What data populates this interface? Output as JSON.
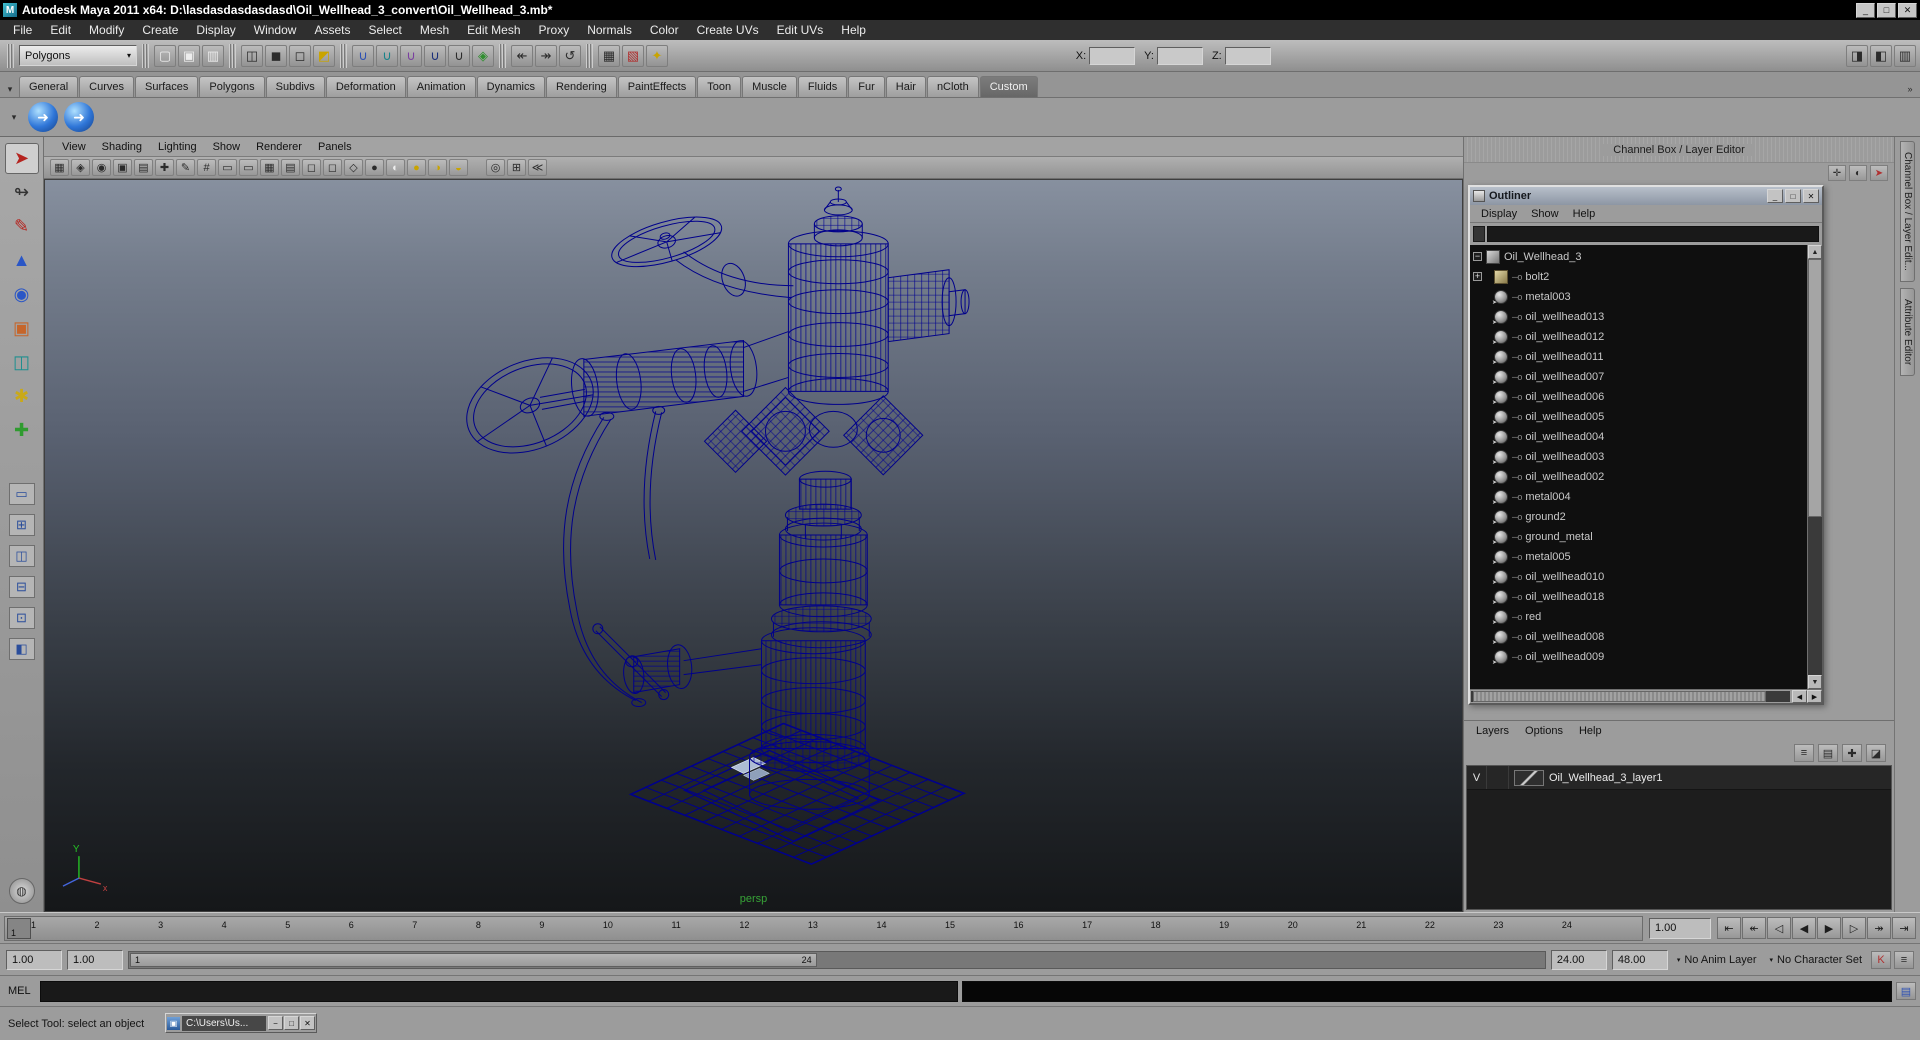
{
  "ui": {
    "caret_down": "▾"
  },
  "titlebar": {
    "app_initial": "M",
    "title": "Autodesk Maya 2011 x64: D:\\lasdasdasdasdasd\\Oil_Wellhead_3_convert\\Oil_Wellhead_3.mb*",
    "buttons": [
      {
        "name": "minimize-button",
        "glyph": "_"
      },
      {
        "name": "maximize-button",
        "glyph": "□"
      },
      {
        "name": "close-button",
        "glyph": "✕"
      }
    ]
  },
  "menu_bar": [
    {
      "name": "menu-file",
      "label": "File"
    },
    {
      "name": "menu-edit",
      "label": "Edit"
    },
    {
      "name": "menu-modify",
      "label": "Modify"
    },
    {
      "name": "menu-create",
      "label": "Create"
    },
    {
      "name": "menu-display",
      "label": "Display"
    },
    {
      "name": "menu-window",
      "label": "Window"
    },
    {
      "name": "menu-assets",
      "label": "Assets"
    },
    {
      "name": "menu-select",
      "label": "Select"
    },
    {
      "name": "menu-mesh",
      "label": "Mesh"
    },
    {
      "name": "menu-edit-mesh",
      "label": "Edit Mesh"
    },
    {
      "name": "menu-proxy",
      "label": "Proxy"
    },
    {
      "name": "menu-normals",
      "label": "Normals"
    },
    {
      "name": "menu-color",
      "label": "Color"
    },
    {
      "name": "menu-create-uvs",
      "label": "Create UVs"
    },
    {
      "name": "menu-edit-uvs",
      "label": "Edit UVs"
    },
    {
      "name": "menu-help",
      "label": "Help"
    }
  ],
  "statusline": {
    "mode": "Polygons",
    "icons_file": [
      {
        "name": "new-scene-icon",
        "glyph": "▢",
        "cls": "c-paper"
      },
      {
        "name": "open-scene-icon",
        "glyph": "▣",
        "cls": "c-paper"
      },
      {
        "name": "save-scene-icon",
        "glyph": "▥",
        "cls": "c-paper"
      }
    ],
    "icons_selection": [
      {
        "name": "select-by-hierarchy-icon",
        "glyph": "◫",
        "cls": "c-dark"
      },
      {
        "name": "select-by-object-icon",
        "glyph": "◼",
        "cls": "c-dark"
      },
      {
        "name": "select-by-component-icon",
        "glyph": "◻",
        "cls": "c-dark"
      },
      {
        "name": "highlight-selection-icon",
        "glyph": "◩",
        "cls": "c-yellow"
      }
    ],
    "icons_snap": [
      {
        "name": "snap-to-grid-icon",
        "glyph": "∪",
        "cls": "c-blue"
      },
      {
        "name": "snap-to-curve-icon",
        "glyph": "∪",
        "cls": "c-teal"
      },
      {
        "name": "snap-to-point-icon",
        "glyph": "∪",
        "cls": "c-purple"
      },
      {
        "name": "snap-to-projected-center-icon",
        "glyph": "∪",
        "cls": "c-navy"
      },
      {
        "name": "snap-to-view-plane-icon",
        "glyph": "∪",
        "cls": "c-dark"
      },
      {
        "name": "make-live-icon",
        "glyph": "◈",
        "cls": "c-green"
      }
    ],
    "icons_history": [
      {
        "name": "input-connections-icon",
        "glyph": "↞",
        "cls": "c-dark"
      },
      {
        "name": "output-connections-icon",
        "glyph": "↠",
        "cls": "c-dark"
      },
      {
        "name": "construction-history-icon",
        "glyph": "↺",
        "cls": "c-dark"
      }
    ],
    "icons_render": [
      {
        "name": "render-current-frame-icon",
        "glyph": "▦",
        "cls": "c-dark"
      },
      {
        "name": "ipr-render-icon",
        "glyph": "▧",
        "cls": "c-red"
      },
      {
        "name": "render-settings-icon",
        "glyph": "✦",
        "cls": "c-yellow"
      }
    ],
    "xyz": [
      {
        "name": "x-coordinate-field",
        "label": "X:"
      },
      {
        "name": "y-coordinate-field",
        "label": "Y:"
      },
      {
        "name": "z-coordinate-field",
        "label": "Z:"
      }
    ],
    "icons_right": [
      {
        "name": "toggle-attribute-editor-icon",
        "glyph": "◨",
        "cls": "c-dark"
      },
      {
        "name": "toggle-tool-settings-icon",
        "glyph": "◧",
        "cls": "c-dark"
      },
      {
        "name": "toggle-channel-box-icon",
        "glyph": "▥",
        "cls": "c-dark"
      }
    ]
  },
  "shelf": {
    "tabs_menu_glyph": "▾",
    "overflow_glyph": "»",
    "tabs": [
      {
        "name": "shelf-tab-general",
        "label": "General"
      },
      {
        "name": "shelf-tab-curves",
        "label": "Curves"
      },
      {
        "name": "shelf-tab-surfaces",
        "label": "Surfaces"
      },
      {
        "name": "shelf-tab-polygons",
        "label": "Polygons"
      },
      {
        "name": "shelf-tab-subdivs",
        "label": "Subdivs"
      },
      {
        "name": "shelf-tab-deformation",
        "label": "Deformation"
      },
      {
        "name": "shelf-tab-animation",
        "label": "Animation"
      },
      {
        "name": "shelf-tab-dynamics",
        "label": "Dynamics"
      },
      {
        "name": "shelf-tab-rendering",
        "label": "Rendering"
      },
      {
        "name": "shelf-tab-painteffects",
        "label": "PaintEffects"
      },
      {
        "name": "shelf-tab-toon",
        "label": "Toon"
      },
      {
        "name": "shelf-tab-muscle",
        "label": "Muscle"
      },
      {
        "name": "shelf-tab-fluids",
        "label": "Fluids"
      },
      {
        "name": "shelf-tab-fur",
        "label": "Fur"
      },
      {
        "name": "shelf-tab-hair",
        "label": "Hair"
      },
      {
        "name": "shelf-tab-ncloth",
        "label": "nCloth"
      },
      {
        "name": "shelf-tab-custom",
        "label": "Custom",
        "active": true
      }
    ],
    "buttons": [
      {
        "name": "shelf-button-1",
        "glyph": "➜"
      },
      {
        "name": "shelf-button-2",
        "glyph": "➜"
      }
    ]
  },
  "toolbox": {
    "tools": [
      {
        "name": "select-tool",
        "glyph": "➤",
        "cls": "t-red",
        "active": true
      },
      {
        "name": "lasso-select-tool",
        "glyph": "↬",
        "cls": "t-dark"
      },
      {
        "name": "paint-selection-tool",
        "glyph": "✎",
        "cls": "t-red"
      },
      {
        "name": "move-tool",
        "glyph": "▲",
        "cls": "t-blue"
      },
      {
        "name": "rotate-tool",
        "glyph": "◉",
        "cls": "t-blue"
      },
      {
        "name": "scale-tool",
        "glyph": "▣",
        "cls": "t-orange"
      },
      {
        "name": "universal-manipulator-tool",
        "glyph": "◫",
        "cls": "t-teal"
      },
      {
        "name": "soft-modification-tool",
        "glyph": "✱",
        "cls": "t-yellow"
      },
      {
        "name": "show-manipulator-tool",
        "glyph": "✚",
        "cls": "t-green"
      }
    ],
    "layouts": [
      {
        "name": "layout-single-pane-icon",
        "glyph": "▭"
      },
      {
        "name": "layout-four-pane-icon",
        "glyph": "⊞"
      },
      {
        "name": "layout-two-pane-side-icon",
        "glyph": "◫"
      },
      {
        "name": "layout-two-pane-stacked-icon",
        "glyph": "⊟"
      },
      {
        "name": "layout-three-pane-icon",
        "glyph": "⊡"
      },
      {
        "name": "layout-outliner-persp-icon",
        "glyph": "◧"
      }
    ],
    "menu_circle_glyph": "◍"
  },
  "panel": {
    "menus": [
      {
        "name": "panel-menu-view",
        "label": "View"
      },
      {
        "name": "panel-menu-shading",
        "label": "Shading"
      },
      {
        "name": "panel-menu-lighting",
        "label": "Lighting"
      },
      {
        "name": "panel-menu-show",
        "label": "Show"
      },
      {
        "name": "panel-menu-renderer",
        "label": "Renderer"
      },
      {
        "name": "panel-menu-panels",
        "label": "Panels"
      }
    ],
    "icons": [
      {
        "name": "camera-select-icon",
        "glyph": "▦",
        "cls": "c-dark"
      },
      {
        "name": "lock-camera-icon",
        "glyph": "◈",
        "cls": "c-dark"
      },
      {
        "name": "camera-attributes-icon",
        "glyph": "◉",
        "cls": "c-dark"
      },
      {
        "name": "bookmark-icon",
        "glyph": "▣",
        "cls": "c-dark"
      },
      {
        "name": "image-plane-icon",
        "glyph": "▤",
        "cls": "c-dark"
      },
      {
        "name": "2d-pan-zoom-icon",
        "glyph": "✚",
        "cls": "c-dark"
      },
      {
        "name": "grease-pencil-icon",
        "glyph": "✎",
        "cls": "c-dark"
      },
      {
        "name": "grid-icon",
        "glyph": "#",
        "cls": "c-dark"
      },
      {
        "name": "film-gate-icon",
        "glyph": "▭",
        "cls": "c-dark"
      },
      {
        "name": "resolution-gate-icon",
        "glyph": "▭",
        "cls": "c-dark"
      },
      {
        "name": "gate-mask-icon",
        "glyph": "▦",
        "cls": "c-dark"
      },
      {
        "name": "field-chart-icon",
        "glyph": "▤",
        "cls": "c-dark"
      },
      {
        "name": "safe-action-icon",
        "glyph": "◻",
        "cls": "c-dark"
      },
      {
        "name": "safe-title-icon",
        "glyph": "◻",
        "cls": "c-dark"
      },
      {
        "name": "wireframe-icon",
        "glyph": "◇",
        "cls": "c-dark"
      },
      {
        "name": "smooth-shade-icon",
        "glyph": "●",
        "cls": "c-dark"
      },
      {
        "name": "textured-icon",
        "glyph": "◐",
        "cls": "c-paper"
      },
      {
        "name": "use-all-lights-icon",
        "glyph": "●",
        "cls": "c-yellow"
      },
      {
        "name": "shadows-icon",
        "glyph": "◑",
        "cls": "c-yellow"
      },
      {
        "name": "ambient-occlusion-icon",
        "glyph": "◒",
        "cls": "c-yellow"
      }
    ],
    "icons2": [
      {
        "name": "isolate-select-icon",
        "glyph": "◎",
        "cls": "c-dark"
      },
      {
        "name": "pane-layout-icon",
        "glyph": "⊞",
        "cls": "c-dark"
      },
      {
        "name": "xray-icon",
        "glyph": "≪",
        "cls": "c-dark"
      }
    ],
    "camera_label": "persp"
  },
  "right": {
    "header": "Channel Box / Layer Editor",
    "header_icons": [
      {
        "name": "channelbox-manip-icon",
        "glyph": "✛",
        "cls": "c-dark"
      },
      {
        "name": "channelbox-speed-icon",
        "glyph": "◐",
        "cls": "c-dark"
      },
      {
        "name": "channelbox-keys-icon",
        "glyph": "➤",
        "cls": "c-red"
      }
    ],
    "side_tabs": [
      {
        "name": "side-tab-channel-box",
        "label": "Channel Box / Layer Edit..."
      },
      {
        "name": "side-tab-attribute-editor",
        "label": "Attribute Editor"
      }
    ]
  },
  "outliner": {
    "title": "Outliner",
    "window_buttons": [
      {
        "name": "outliner-minimize-button",
        "glyph": "_"
      },
      {
        "name": "outliner-maximize-button",
        "glyph": "□"
      },
      {
        "name": "outliner-close-button",
        "glyph": "✕"
      }
    ],
    "menus": [
      {
        "name": "outliner-menu-display",
        "label": "Display"
      },
      {
        "name": "outliner-menu-show",
        "label": "Show"
      },
      {
        "name": "outliner-menu-help",
        "label": "Help"
      }
    ],
    "items": [
      {
        "label": "Oil_Wellhead_3",
        "icon": "transform",
        "expander": "minus",
        "cls": "root"
      },
      {
        "label": "bolt2",
        "icon": "mesh",
        "expander": "plus"
      },
      {
        "label": "metal003",
        "icon": "material"
      },
      {
        "label": "oil_wellhead013",
        "icon": "material"
      },
      {
        "label": "oil_wellhead012",
        "icon": "material"
      },
      {
        "label": "oil_wellhead011",
        "icon": "material"
      },
      {
        "label": "oil_wellhead007",
        "icon": "material"
      },
      {
        "label": "oil_wellhead006",
        "icon": "material"
      },
      {
        "label": "oil_wellhead005",
        "icon": "material"
      },
      {
        "label": "oil_wellhead004",
        "icon": "material"
      },
      {
        "label": "oil_wellhead003",
        "icon": "material"
      },
      {
        "label": "oil_wellhead002",
        "icon": "material"
      },
      {
        "label": "metal004",
        "icon": "material"
      },
      {
        "label": "ground2",
        "icon": "material"
      },
      {
        "label": "ground_metal",
        "icon": "material"
      },
      {
        "label": "metal005",
        "icon": "material"
      },
      {
        "label": "oil_wellhead010",
        "icon": "material"
      },
      {
        "label": "oil_wellhead018",
        "icon": "material"
      },
      {
        "label": "red",
        "icon": "material"
      },
      {
        "label": "oil_wellhead008",
        "icon": "material"
      },
      {
        "label": "oil_wellhead009",
        "icon": "material"
      }
    ]
  },
  "layers": {
    "menus": [
      {
        "name": "layers-menu-layers",
        "label": "Layers"
      },
      {
        "name": "layers-menu-options",
        "label": "Options"
      },
      {
        "name": "layers-menu-help",
        "label": "Help"
      }
    ],
    "icons": [
      {
        "name": "layer-mode-icon",
        "glyph": "≡",
        "cls": "c-dark"
      },
      {
        "name": "layer-sort-icon",
        "glyph": "▤",
        "cls": "c-dark"
      },
      {
        "name": "new-empty-layer-icon",
        "glyph": "✚",
        "cls": "c-dark"
      },
      {
        "name": "new-layer-from-selected-icon",
        "glyph": "◪",
        "cls": "c-dark"
      }
    ],
    "layer": {
      "visibility": "V",
      "name": "Oil_Wellhead_3_layer1"
    }
  },
  "timeline": {
    "frames": [
      "1",
      "2",
      "3",
      "4",
      "5",
      "6",
      "7",
      "8",
      "9",
      "10",
      "11",
      "12",
      "13",
      "14",
      "15",
      "16",
      "17",
      "18",
      "19",
      "20",
      "21",
      "22",
      "23",
      "24"
    ],
    "playhead": "1",
    "current_time": "1.00",
    "transport": [
      {
        "name": "go-to-start-button",
        "glyph": "⇤"
      },
      {
        "name": "step-back-key-button",
        "glyph": "↞"
      },
      {
        "name": "step-back-frame-button",
        "glyph": "◁"
      },
      {
        "name": "play-backwards-button",
        "glyph": "◀"
      },
      {
        "name": "play-forwards-button",
        "glyph": "▶"
      },
      {
        "name": "step-forward-frame-button",
        "glyph": "▷"
      },
      {
        "name": "step-forward-key-button",
        "glyph": "↠"
      },
      {
        "name": "go-to-end-button",
        "glyph": "⇥"
      }
    ]
  },
  "range": {
    "anim_start": "1.00",
    "playback_start": "1.00",
    "inner_start": "1",
    "inner_end": "24",
    "playback_end": "24.00",
    "anim_end": "48.00",
    "anim_layer": "No Anim Layer",
    "character_set": "No Character Set",
    "icons": [
      {
        "name": "auto-keyframe-icon",
        "glyph": "K",
        "cls": "c-red"
      },
      {
        "name": "animation-preferences-icon",
        "glyph": "≡",
        "cls": "c-dark"
      }
    ]
  },
  "command_line": {
    "label": "MEL",
    "script_editor_icon_glyph": "▤"
  },
  "help_line": {
    "text": "Select Tool: select an object",
    "taskbar": {
      "icon_glyph": "▣",
      "title": "C:\\Users\\Us...",
      "buttons": [
        {
          "name": "taskbar-minimize-button",
          "glyph": "−"
        },
        {
          "name": "taskbar-restore-button",
          "glyph": "□"
        },
        {
          "name": "taskbar-close-button",
          "glyph": "✕"
        }
      ]
    }
  }
}
